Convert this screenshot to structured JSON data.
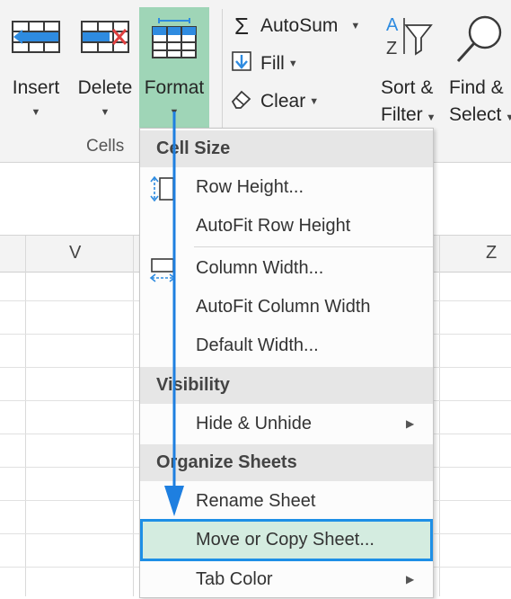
{
  "ribbon": {
    "insert": {
      "label": "Insert"
    },
    "delete": {
      "label": "Delete"
    },
    "format": {
      "label": "Format"
    },
    "group_label": "Cells",
    "autosum": {
      "label": "AutoSum"
    },
    "fill": {
      "label": "Fill"
    },
    "clear": {
      "label": "Clear"
    },
    "sort_filter": {
      "line1": "Sort &",
      "line2": "Filter"
    },
    "find_select": {
      "line1": "Find &",
      "line2": "Select"
    }
  },
  "grid": {
    "columns": [
      "V",
      "Z"
    ]
  },
  "menu": {
    "cell_size": {
      "header": "Cell Size",
      "row_height": "Row Height...",
      "autofit_row_height": "AutoFit Row Height",
      "column_width": "Column Width...",
      "autofit_column_width": "AutoFit Column Width",
      "default_width": "Default Width..."
    },
    "visibility": {
      "header": "Visibility",
      "hide_unhide": "Hide & Unhide"
    },
    "organize": {
      "header": "Organize Sheets",
      "rename_sheet": "Rename Sheet",
      "move_copy_sheet": "Move or Copy Sheet...",
      "tab_color": "Tab Color"
    }
  },
  "colors": {
    "format_active": "#9fd5b7",
    "highlight_fill": "#d4ece0",
    "highlight_border": "#1e8fe6",
    "arrow": "#1e7fe0"
  },
  "highlighted_item": "Move or Copy Sheet..."
}
